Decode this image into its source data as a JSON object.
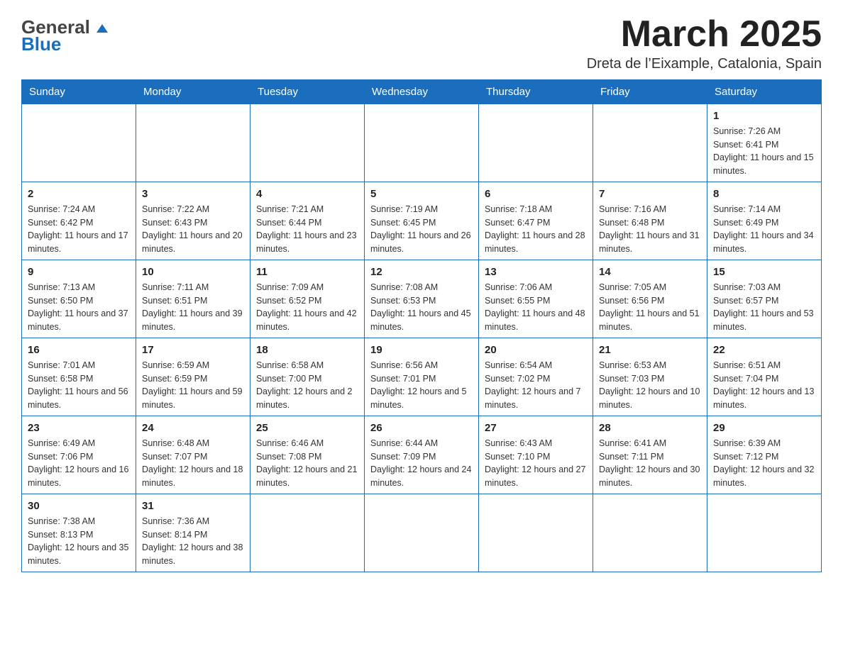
{
  "header": {
    "logo_general": "General",
    "logo_blue": "Blue",
    "title": "March 2025",
    "subtitle": "Dreta de l’Eixample, Catalonia, Spain"
  },
  "weekdays": [
    "Sunday",
    "Monday",
    "Tuesday",
    "Wednesday",
    "Thursday",
    "Friday",
    "Saturday"
  ],
  "weeks": [
    [
      {
        "day": "",
        "sunrise": "",
        "sunset": "",
        "daylight": ""
      },
      {
        "day": "",
        "sunrise": "",
        "sunset": "",
        "daylight": ""
      },
      {
        "day": "",
        "sunrise": "",
        "sunset": "",
        "daylight": ""
      },
      {
        "day": "",
        "sunrise": "",
        "sunset": "",
        "daylight": ""
      },
      {
        "day": "",
        "sunrise": "",
        "sunset": "",
        "daylight": ""
      },
      {
        "day": "",
        "sunrise": "",
        "sunset": "",
        "daylight": ""
      },
      {
        "day": "1",
        "sunrise": "Sunrise: 7:26 AM",
        "sunset": "Sunset: 6:41 PM",
        "daylight": "Daylight: 11 hours and 15 minutes."
      }
    ],
    [
      {
        "day": "2",
        "sunrise": "Sunrise: 7:24 AM",
        "sunset": "Sunset: 6:42 PM",
        "daylight": "Daylight: 11 hours and 17 minutes."
      },
      {
        "day": "3",
        "sunrise": "Sunrise: 7:22 AM",
        "sunset": "Sunset: 6:43 PM",
        "daylight": "Daylight: 11 hours and 20 minutes."
      },
      {
        "day": "4",
        "sunrise": "Sunrise: 7:21 AM",
        "sunset": "Sunset: 6:44 PM",
        "daylight": "Daylight: 11 hours and 23 minutes."
      },
      {
        "day": "5",
        "sunrise": "Sunrise: 7:19 AM",
        "sunset": "Sunset: 6:45 PM",
        "daylight": "Daylight: 11 hours and 26 minutes."
      },
      {
        "day": "6",
        "sunrise": "Sunrise: 7:18 AM",
        "sunset": "Sunset: 6:47 PM",
        "daylight": "Daylight: 11 hours and 28 minutes."
      },
      {
        "day": "7",
        "sunrise": "Sunrise: 7:16 AM",
        "sunset": "Sunset: 6:48 PM",
        "daylight": "Daylight: 11 hours and 31 minutes."
      },
      {
        "day": "8",
        "sunrise": "Sunrise: 7:14 AM",
        "sunset": "Sunset: 6:49 PM",
        "daylight": "Daylight: 11 hours and 34 minutes."
      }
    ],
    [
      {
        "day": "9",
        "sunrise": "Sunrise: 7:13 AM",
        "sunset": "Sunset: 6:50 PM",
        "daylight": "Daylight: 11 hours and 37 minutes."
      },
      {
        "day": "10",
        "sunrise": "Sunrise: 7:11 AM",
        "sunset": "Sunset: 6:51 PM",
        "daylight": "Daylight: 11 hours and 39 minutes."
      },
      {
        "day": "11",
        "sunrise": "Sunrise: 7:09 AM",
        "sunset": "Sunset: 6:52 PM",
        "daylight": "Daylight: 11 hours and 42 minutes."
      },
      {
        "day": "12",
        "sunrise": "Sunrise: 7:08 AM",
        "sunset": "Sunset: 6:53 PM",
        "daylight": "Daylight: 11 hours and 45 minutes."
      },
      {
        "day": "13",
        "sunrise": "Sunrise: 7:06 AM",
        "sunset": "Sunset: 6:55 PM",
        "daylight": "Daylight: 11 hours and 48 minutes."
      },
      {
        "day": "14",
        "sunrise": "Sunrise: 7:05 AM",
        "sunset": "Sunset: 6:56 PM",
        "daylight": "Daylight: 11 hours and 51 minutes."
      },
      {
        "day": "15",
        "sunrise": "Sunrise: 7:03 AM",
        "sunset": "Sunset: 6:57 PM",
        "daylight": "Daylight: 11 hours and 53 minutes."
      }
    ],
    [
      {
        "day": "16",
        "sunrise": "Sunrise: 7:01 AM",
        "sunset": "Sunset: 6:58 PM",
        "daylight": "Daylight: 11 hours and 56 minutes."
      },
      {
        "day": "17",
        "sunrise": "Sunrise: 6:59 AM",
        "sunset": "Sunset: 6:59 PM",
        "daylight": "Daylight: 11 hours and 59 minutes."
      },
      {
        "day": "18",
        "sunrise": "Sunrise: 6:58 AM",
        "sunset": "Sunset: 7:00 PM",
        "daylight": "Daylight: 12 hours and 2 minutes."
      },
      {
        "day": "19",
        "sunrise": "Sunrise: 6:56 AM",
        "sunset": "Sunset: 7:01 PM",
        "daylight": "Daylight: 12 hours and 5 minutes."
      },
      {
        "day": "20",
        "sunrise": "Sunrise: 6:54 AM",
        "sunset": "Sunset: 7:02 PM",
        "daylight": "Daylight: 12 hours and 7 minutes."
      },
      {
        "day": "21",
        "sunrise": "Sunrise: 6:53 AM",
        "sunset": "Sunset: 7:03 PM",
        "daylight": "Daylight: 12 hours and 10 minutes."
      },
      {
        "day": "22",
        "sunrise": "Sunrise: 6:51 AM",
        "sunset": "Sunset: 7:04 PM",
        "daylight": "Daylight: 12 hours and 13 minutes."
      }
    ],
    [
      {
        "day": "23",
        "sunrise": "Sunrise: 6:49 AM",
        "sunset": "Sunset: 7:06 PM",
        "daylight": "Daylight: 12 hours and 16 minutes."
      },
      {
        "day": "24",
        "sunrise": "Sunrise: 6:48 AM",
        "sunset": "Sunset: 7:07 PM",
        "daylight": "Daylight: 12 hours and 18 minutes."
      },
      {
        "day": "25",
        "sunrise": "Sunrise: 6:46 AM",
        "sunset": "Sunset: 7:08 PM",
        "daylight": "Daylight: 12 hours and 21 minutes."
      },
      {
        "day": "26",
        "sunrise": "Sunrise: 6:44 AM",
        "sunset": "Sunset: 7:09 PM",
        "daylight": "Daylight: 12 hours and 24 minutes."
      },
      {
        "day": "27",
        "sunrise": "Sunrise: 6:43 AM",
        "sunset": "Sunset: 7:10 PM",
        "daylight": "Daylight: 12 hours and 27 minutes."
      },
      {
        "day": "28",
        "sunrise": "Sunrise: 6:41 AM",
        "sunset": "Sunset: 7:11 PM",
        "daylight": "Daylight: 12 hours and 30 minutes."
      },
      {
        "day": "29",
        "sunrise": "Sunrise: 6:39 AM",
        "sunset": "Sunset: 7:12 PM",
        "daylight": "Daylight: 12 hours and 32 minutes."
      }
    ],
    [
      {
        "day": "30",
        "sunrise": "Sunrise: 7:38 AM",
        "sunset": "Sunset: 8:13 PM",
        "daylight": "Daylight: 12 hours and 35 minutes."
      },
      {
        "day": "31",
        "sunrise": "Sunrise: 7:36 AM",
        "sunset": "Sunset: 8:14 PM",
        "daylight": "Daylight: 12 hours and 38 minutes."
      },
      {
        "day": "",
        "sunrise": "",
        "sunset": "",
        "daylight": ""
      },
      {
        "day": "",
        "sunrise": "",
        "sunset": "",
        "daylight": ""
      },
      {
        "day": "",
        "sunrise": "",
        "sunset": "",
        "daylight": ""
      },
      {
        "day": "",
        "sunrise": "",
        "sunset": "",
        "daylight": ""
      },
      {
        "day": "",
        "sunrise": "",
        "sunset": "",
        "daylight": ""
      }
    ]
  ]
}
